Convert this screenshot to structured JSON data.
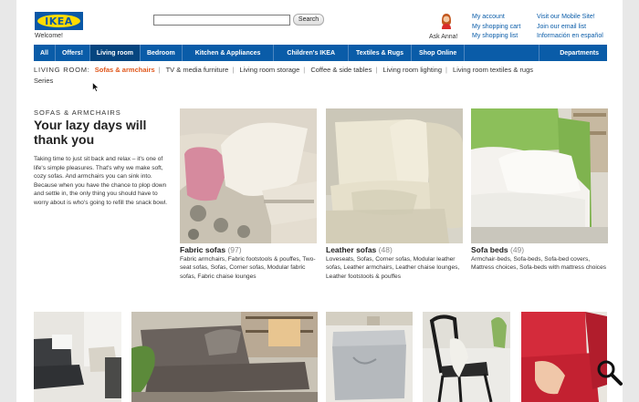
{
  "header": {
    "logo_text": "IKEA",
    "welcome": "Welcome!",
    "search_button": "Search",
    "search_value": "",
    "ask_anna": "Ask Anna!"
  },
  "account_links": [
    "My account",
    "My shopping cart",
    "My shopping list"
  ],
  "info_links": [
    "Visit our Mobile Site!",
    "Join our email list",
    "Información en español"
  ],
  "nav": {
    "items": [
      "All",
      "Offers!",
      "Living room",
      "Bedroom",
      "Kitchen & Appliances",
      "Children's IKEA",
      "Textiles & Rugs",
      "Shop Online"
    ],
    "active": "Living room",
    "departments": "Departments"
  },
  "subnav": {
    "prefix": "LIVING ROOM:",
    "current": "Sofas & armchairs",
    "items": [
      "TV & media furniture",
      "Living room storage",
      "Coffee & side tables",
      "Living room lighting",
      "Living room textiles & rugs",
      "Series"
    ]
  },
  "hero": {
    "section_label": "SOFAS & ARMCHAIRS",
    "headline": "Your lazy days will thank you",
    "intro": "Taking time to just sit back and relax – it's one of life's simple pleasures. That's why we make soft, cozy sofas. And armchairs you can sink into. Because when you have the chance to plop down and settle in, the only thing you should have to worry about is who's going to refill the snack bowl."
  },
  "products": [
    {
      "title": "Fabric sofas",
      "count": "(97)",
      "desc": "Fabric armchairs, Fabric footstools & pouffes, Two-seat sofas, Sofas, Corner sofas, Modular fabric sofas, Fabric chaise lounges"
    },
    {
      "title": "Leather sofas",
      "count": "(48)",
      "desc": "Loveseats, Sofas, Corner sofas, Modular leather sofas, Leather armchairs, Leather chaise lounges, Leather footstools & pouffes"
    },
    {
      "title": "Sofa beds",
      "count": "(49)",
      "desc": "Armchair-beds, Sofa-beds, Sofa-bed covers, Mattress choices, Sofa-beds with mattress choices"
    }
  ],
  "colors": {
    "brand_blue": "#0a5ca8",
    "brand_yellow": "#ffdb00",
    "accent_orange": "#e0571b",
    "link_blue": "#0a5ca8"
  }
}
